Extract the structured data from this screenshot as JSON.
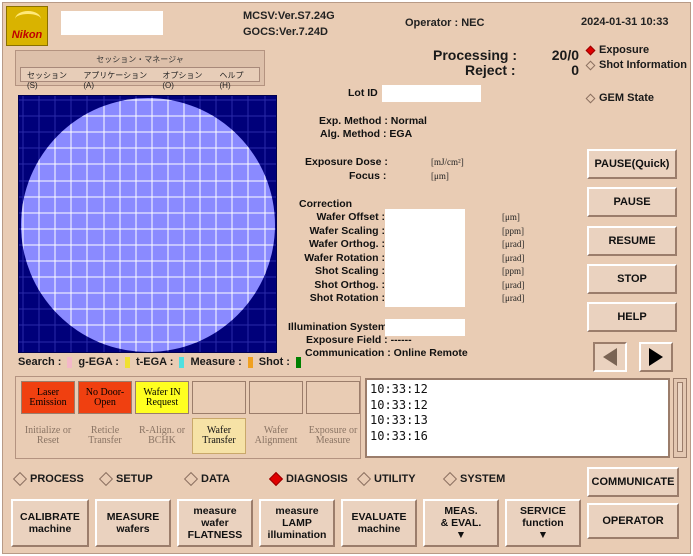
{
  "header": {
    "brand": "Nikon",
    "mcsv": "MCSV:Ver.S7.24G",
    "gocs": "GOCS:Ver.7.24D",
    "operator": "Operator : NEC",
    "datetime": "2024-01-31 10:33"
  },
  "session_manager": {
    "title": "セッション・マネージャ",
    "menu": [
      "セッション(S)",
      "アプリケーション(A)",
      "オプション(O)",
      "ヘルプ(H)"
    ]
  },
  "status": {
    "processing_label": "Processing :",
    "processing_value": "20/0",
    "reject_label": "Reject :",
    "reject_value": "0"
  },
  "info": {
    "lot_id_label": "Lot ID",
    "exp_method": "Exp. Method : Normal",
    "alg_method": "Alg. Method : EGA",
    "exposure_dose_label": "Exposure Dose :",
    "exposure_dose_unit": "[mJ/cm²]",
    "focus_label": "Focus :",
    "focus_unit": "[μm]",
    "correction_title": "Correction",
    "correction_rows": [
      {
        "label": "Wafer Offset :",
        "unit": "[μm]"
      },
      {
        "label": "Wafer Scaling :",
        "unit": "[ppm]"
      },
      {
        "label": "Wafer Orthog. :",
        "unit": "[μrad]"
      },
      {
        "label": "Wafer Rotation :",
        "unit": "[μrad]"
      },
      {
        "label": "Shot Scaling :",
        "unit": "[ppm]"
      },
      {
        "label": "Shot Orthog. :",
        "unit": "[μrad]"
      },
      {
        "label": "Shot Rotation :",
        "unit": "[μrad]"
      }
    ],
    "illumination_label": "Illumination System :",
    "exposure_field": "Exposure Field : ------",
    "communication": "Communication : Online Remote"
  },
  "legend": {
    "search": "Search :",
    "items": [
      {
        "label": "g-EGA :",
        "color": "#f4b8c8"
      },
      {
        "label": "t-EGA :",
        "color": "#f0e030"
      },
      {
        "label": "Measure :",
        "color": "#50e0e0"
      },
      {
        "label": "Shot :",
        "color": "#f0a020"
      },
      {
        "label": "",
        "color": "#008000"
      }
    ]
  },
  "right_panel": {
    "radios": [
      {
        "label": "Exposure",
        "selected": true
      },
      {
        "label": "Shot Information",
        "selected": false
      },
      {
        "label": "GEM State",
        "selected": false
      }
    ],
    "buttons": [
      "PAUSE(Quick)",
      "PAUSE",
      "RESUME",
      "STOP",
      "HELP"
    ],
    "communicate": "COMMUNICATE",
    "operator_btn": "OPERATOR"
  },
  "lamps_top": [
    {
      "text": "Laser Emission",
      "bg": "#f04010",
      "color": "#000000"
    },
    {
      "text": "No Door-Open",
      "bg": "#f04010",
      "color": "#000000"
    },
    {
      "text": "Wafer IN Request",
      "bg": "#ffff20",
      "color": "#000000"
    },
    {
      "text": "",
      "bg": "#e9ccb4",
      "color": "#000000"
    },
    {
      "text": "",
      "bg": "#e9ccb4",
      "color": "#000000"
    },
    {
      "text": "",
      "bg": "#e9ccb4",
      "color": "#000000"
    }
  ],
  "lamps_bottom": [
    {
      "text": "Initialize or Reset",
      "active": false
    },
    {
      "text": "Reticle Transfer",
      "active": false
    },
    {
      "text": "R-Align. or BCHK",
      "active": false
    },
    {
      "text": "Wafer Transfer",
      "active": true
    },
    {
      "text": "Wafer Alignment",
      "active": false
    },
    {
      "text": "Exposure or Measure",
      "active": false
    }
  ],
  "log_lines": [
    "10:33:12",
    "10:33:12",
    "10:33:13",
    "10:33:16"
  ],
  "modes": [
    {
      "label": "PROCESS",
      "selected": false
    },
    {
      "label": "SETUP",
      "selected": false
    },
    {
      "label": "DATA",
      "selected": false
    },
    {
      "label": "DIAGNOSIS",
      "selected": true
    },
    {
      "label": "UTILITY",
      "selected": false
    },
    {
      "label": "SYSTEM",
      "selected": false
    }
  ],
  "bottom_buttons": [
    {
      "line1": "CALIBRATE",
      "line2": "machine",
      "line3": ""
    },
    {
      "line1": "MEASURE",
      "line2": "wafers",
      "line3": ""
    },
    {
      "line1": "measure",
      "line2": "wafer",
      "line3": "FLATNESS"
    },
    {
      "line1": "measure",
      "line2": "LAMP",
      "line3": "illumination"
    },
    {
      "line1": "EVALUATE",
      "line2": "machine",
      "line3": ""
    },
    {
      "line1": "MEAS.",
      "line2": "& EVAL.",
      "line3": "▼"
    },
    {
      "line1": "SERVICE",
      "line2": "function",
      "line3": "▼"
    }
  ],
  "colors": {
    "panel": "#e9ccb4",
    "wafer_bg": "#00007a",
    "wafer_disc": "#8a8aff",
    "grid": "#ffffff"
  }
}
